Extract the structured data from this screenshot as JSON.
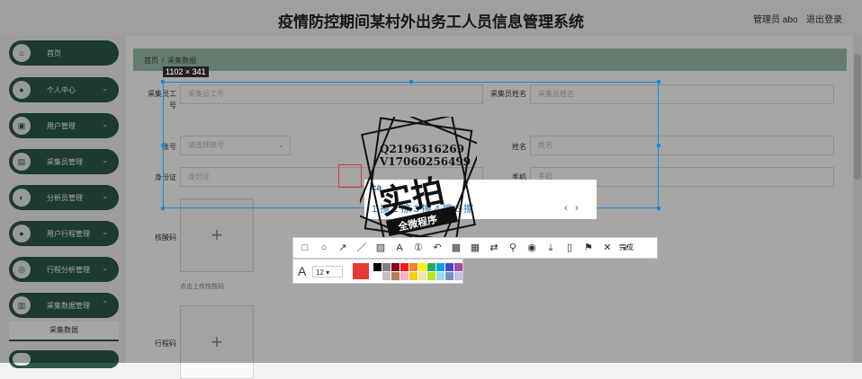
{
  "header": {
    "title": "疫情防控期间某村外出务工人员信息管理系统",
    "admin": "管理员 abo",
    "logout": "退出登录"
  },
  "sidebar": {
    "items": [
      {
        "label": "首页",
        "icon": "home-icon"
      },
      {
        "label": "个人中心",
        "icon": "person-icon"
      },
      {
        "label": "用户管理",
        "icon": "user-icon"
      },
      {
        "label": "采集员管理",
        "icon": "collector-icon"
      },
      {
        "label": "分析员管理",
        "icon": "analyst-icon"
      },
      {
        "label": "用户行程管理",
        "icon": "trip-icon"
      },
      {
        "label": "行程分析管理",
        "icon": "analysis-icon"
      },
      {
        "label": "采集数据管理",
        "icon": "data-icon"
      }
    ],
    "submenu": "采集数据"
  },
  "breadcrumb": {
    "home": "首页",
    "current": "采集数据"
  },
  "form": {
    "collector_id_label": "采集员工号",
    "collector_id_placeholder": "采集员工号",
    "collector_name_label": "采集员姓名",
    "collector_name_placeholder": "采集员姓名",
    "account_label": "账号",
    "account_placeholder": "请选择账号",
    "name_label": "姓名",
    "name_placeholder": "姓名",
    "idcard_label": "身份证",
    "idcard_placeholder": "身份证",
    "phone_label": "手机",
    "phone_placeholder": "手机",
    "health_code_label": "核酸码",
    "health_upload_hint": "点击上传核酸码",
    "trip_code_label": "行程码"
  },
  "capture": {
    "size": "1102 × 341",
    "done_label": "完成",
    "font_size": "12",
    "colors": [
      "#000000",
      "#7f7f7f",
      "#880015",
      "#ed1c24",
      "#ff7f27",
      "#fff200",
      "#22b14c",
      "#00a2e8",
      "#3f48cc",
      "#a349a4",
      "#ffffff",
      "#c3c3c3",
      "#b97a57",
      "#ffaec9",
      "#ffc90e",
      "#efe4b0",
      "#b5e61d",
      "#99d9ea",
      "#7092be",
      "#c8bfe7"
    ],
    "current_color": "#e53935"
  },
  "overlay": {
    "cad_text": "ca",
    "row_text": "1 擦 2 擦 3 擦 4 擦 5 擦",
    "nav_prev": "‹",
    "nav_next": "›"
  },
  "stamp": {
    "line1": "Q2196316269",
    "line2": "V17060256499",
    "big": "实拍",
    "ribbon": "全微程序"
  }
}
